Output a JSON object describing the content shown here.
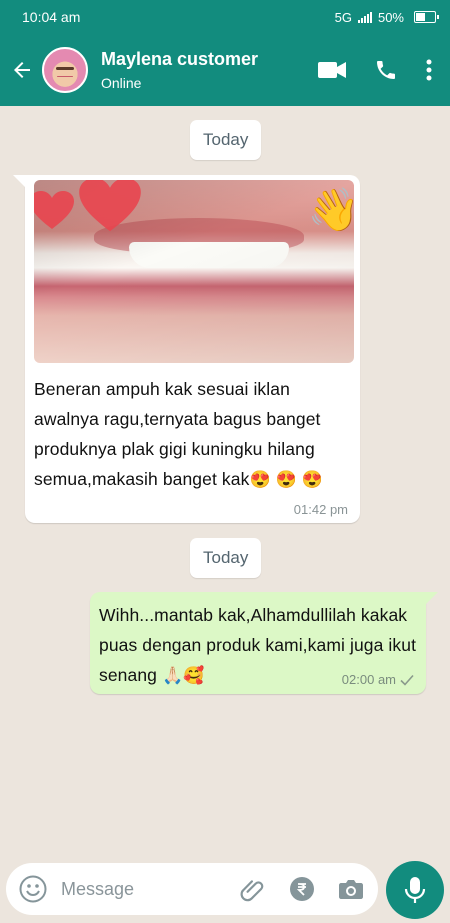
{
  "status_bar": {
    "time": "10:04 am",
    "network": "5G",
    "battery": "50%",
    "battery_level": 0.5
  },
  "header": {
    "contact_name": "Maylena customer",
    "status": "Online"
  },
  "icons": {
    "back": "arrow-left-icon",
    "video": "video-camera-icon",
    "call": "phone-icon",
    "menu": "more-vertical-icon",
    "emoji": "emoji-icon",
    "attach": "paperclip-icon",
    "payment": "rupee-icon",
    "camera": "camera-icon",
    "mic": "microphone-icon",
    "photo_overlays": [
      "heart-icon",
      "heart-icon",
      "waving-hand-icon"
    ],
    "read": "check-icon"
  },
  "colors": {
    "header": "#128c7e",
    "chat_bg": "#ece5dd",
    "incoming": "#ffffff",
    "outgoing": "#dcf8c6"
  },
  "messages": [
    {
      "date_divider": "Today",
      "direction": "incoming",
      "has_photo": true,
      "text": " Beneran ampuh kak sesuai iklan awalnya ragu,ternyata bagus banget produknya plak gigi kuningku hilang semua,makasih banget kak",
      "emoji": "😍 😍 😍",
      "time": "01:42 pm"
    },
    {
      "date_divider": "Today",
      "direction": "outgoing",
      "text": "Wihh...mantab kak,Alhamdullilah kakak puas dengan produk kami,kami juga ikut senang",
      "emoji": "🙏🏻🥰",
      "time": "02:00 am",
      "status": "sent"
    }
  ],
  "composer": {
    "placeholder": "Message"
  }
}
